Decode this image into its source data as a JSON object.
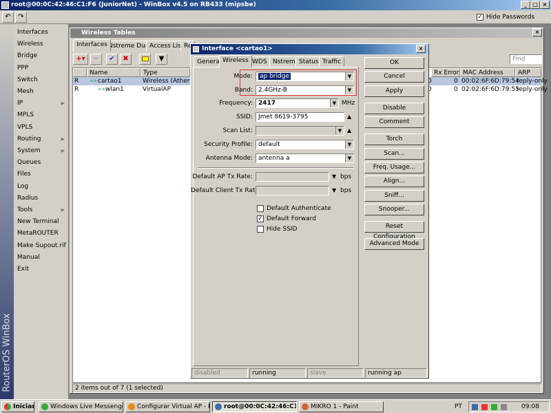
{
  "window": {
    "title": "root@00:0C:42:46:C1:F6 (JuniorNet) - WinBox v4.5 on RB433 (mipsbe)"
  },
  "toolbar": {
    "undo_icon": "undo-icon",
    "redo_icon": "redo-icon",
    "hide_passwords_label": "Hide Passwords",
    "hide_passwords_checked": true
  },
  "sidebar": {
    "brand": "RouterOS WinBox",
    "items": [
      {
        "label": "Interfaces",
        "submenu": false
      },
      {
        "label": "Wireless",
        "submenu": false
      },
      {
        "label": "Bridge",
        "submenu": false
      },
      {
        "label": "PPP",
        "submenu": false
      },
      {
        "label": "Switch",
        "submenu": false
      },
      {
        "label": "Mesh",
        "submenu": false
      },
      {
        "label": "IP",
        "submenu": true
      },
      {
        "label": "MPLS",
        "submenu": false
      },
      {
        "label": "VPLS",
        "submenu": false
      },
      {
        "label": "Routing",
        "submenu": true
      },
      {
        "label": "System",
        "submenu": true
      },
      {
        "label": "Queues",
        "submenu": false
      },
      {
        "label": "Files",
        "submenu": false
      },
      {
        "label": "Log",
        "submenu": false
      },
      {
        "label": "Radius",
        "submenu": false
      },
      {
        "label": "Tools",
        "submenu": true
      },
      {
        "label": "New Terminal",
        "submenu": false
      },
      {
        "label": "MetaROUTER",
        "submenu": false
      },
      {
        "label": "Make Supout.rif",
        "submenu": false
      },
      {
        "label": "Manual",
        "submenu": false
      },
      {
        "label": "Exit",
        "submenu": false
      }
    ]
  },
  "wireless_tables": {
    "title": "Wireless Tables",
    "tabs": [
      "Interfaces",
      "Nstreme Dual",
      "Access List",
      "Re"
    ],
    "find_placeholder": "Find",
    "columns": [
      "Name",
      "Type",
      "Rx Errors",
      "MAC Address",
      "ARP"
    ],
    "rows": [
      {
        "flag": "R",
        "name": "cartao1",
        "type": "Wireless (Atheros A",
        "rx_errors_partial": "0",
        "rx_errors": "0",
        "mac": "00:02:6F:6D:79:54",
        "arp": "reply-only"
      },
      {
        "flag": "R",
        "name": "wlan1",
        "type": "VirtualAP",
        "rx_errors_partial": "0",
        "rx_errors": "0",
        "mac": "02:02:6F:6D:79:55",
        "arp": "reply-only"
      }
    ],
    "status": "2 items out of 7 (1 selected)"
  },
  "dialog": {
    "title": "Interface <cartao1>",
    "tabs": [
      "General",
      "Wireless",
      "WDS",
      "Nstreme",
      "Status",
      "Traffic"
    ],
    "fields": {
      "mode_label": "Mode:",
      "mode": "ap bridge",
      "band_label": "Band:",
      "band": "2.4GHz-B",
      "frequency_label": "Frequency:",
      "frequency": "2417",
      "frequency_unit": "MHz",
      "ssid_label": "SSID:",
      "ssid": "Jmet 8619-3795",
      "scan_list_label": "Scan List:",
      "scan_list": "",
      "security_profile_label": "Security Profile:",
      "security_profile": "default",
      "antenna_mode_label": "Antenna Mode:",
      "antenna_mode": "antenna a",
      "default_ap_tx_label": "Default AP Tx Rate:",
      "default_ap_tx": "",
      "default_client_tx_label": "Default Client Tx Rate:",
      "default_client_tx": "",
      "bps": "bps"
    },
    "checkboxes": [
      {
        "label": "Default Authenticate",
        "checked": false
      },
      {
        "label": "Default Forward",
        "checked": true
      },
      {
        "label": "Hide SSID",
        "checked": false
      }
    ],
    "buttons": [
      "OK",
      "Cancel",
      "Apply",
      "Disable",
      "Comment",
      "Torch",
      "Scan...",
      "Freq. Usage...",
      "Align...",
      "Sniff...",
      "Snooper...",
      "Reset Configuration",
      "Advanced Mode"
    ],
    "status": [
      "disabled",
      "running",
      "slave",
      "running ap"
    ]
  },
  "taskbar": {
    "start": "Iniciar",
    "tasks": [
      "Windows Live Messenger",
      "Configurar Virtual AP - P...",
      "root@00:0C:42:46:C1:...",
      "MIKRO 1 - Paint"
    ],
    "lang": "PT",
    "clock": "09:08"
  }
}
